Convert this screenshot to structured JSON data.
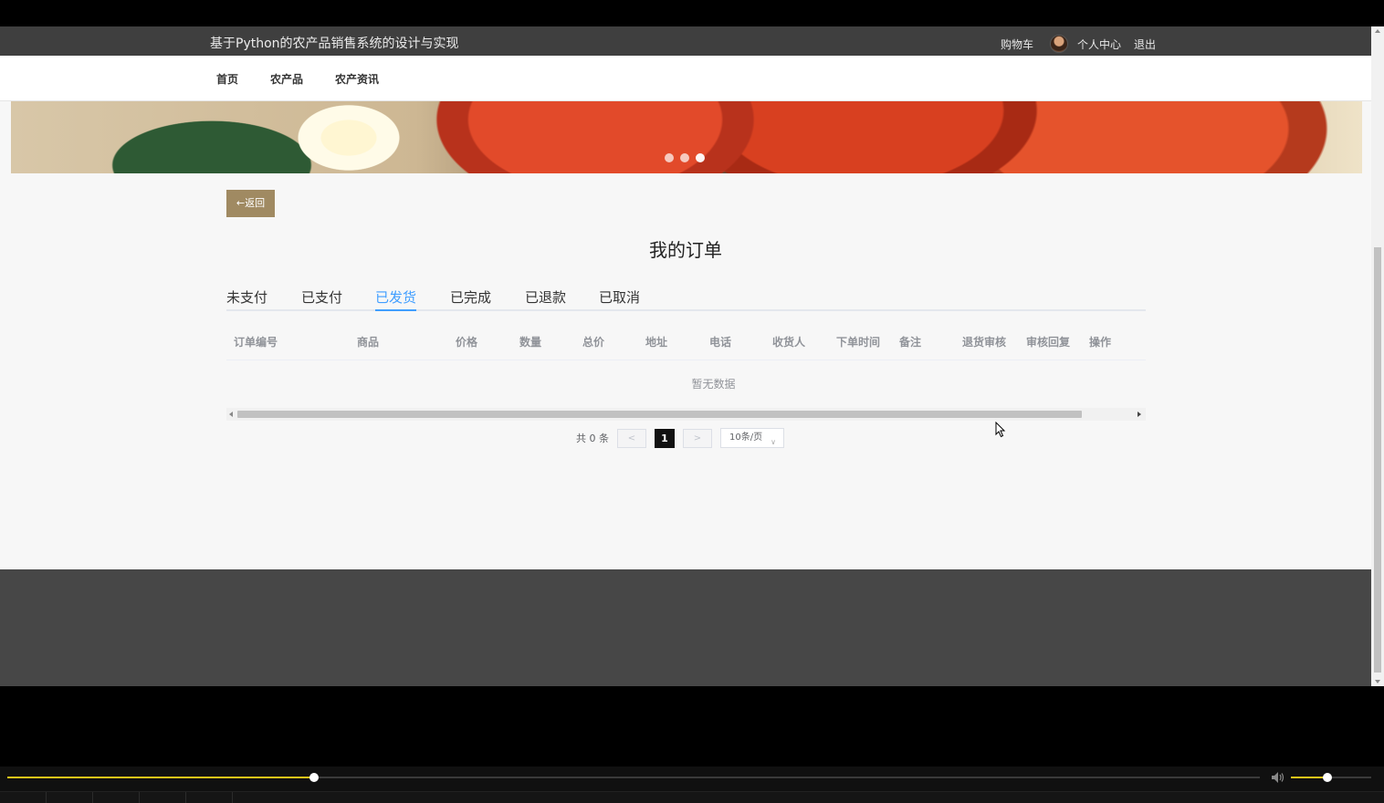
{
  "header": {
    "site_title": "基于Python的农产品销售系统的设计与实现",
    "cart": "购物车",
    "profile": "个人中心",
    "logout": "退出"
  },
  "nav": {
    "items": [
      "首页",
      "农产品",
      "农产资讯"
    ]
  },
  "banner": {
    "dot_count": 3,
    "active_dot": 2
  },
  "content": {
    "back_label": "←返回",
    "page_title": "我的订单",
    "tabs": [
      "未支付",
      "已支付",
      "已发货",
      "已完成",
      "已退款",
      "已取消"
    ],
    "active_tab": 2,
    "columns": [
      "订单编号",
      "商品",
      "价格",
      "数量",
      "总价",
      "地址",
      "电话",
      "收货人",
      "下单时间",
      "备注",
      "退货审核",
      "审核回复",
      "操作"
    ],
    "empty_text": "暂无数据"
  },
  "pagination": {
    "total": "共 0 条",
    "prev": "<",
    "current_page": "1",
    "next": ">",
    "page_size": "10条/页"
  },
  "player": {
    "progress": 0.245,
    "volume": 0.45
  },
  "colors": {
    "accent": "#409eff",
    "back_button": "#a08a62",
    "header_bg": "#3f3f3f",
    "footer_bg": "#474747",
    "progress": "#e6c419"
  }
}
